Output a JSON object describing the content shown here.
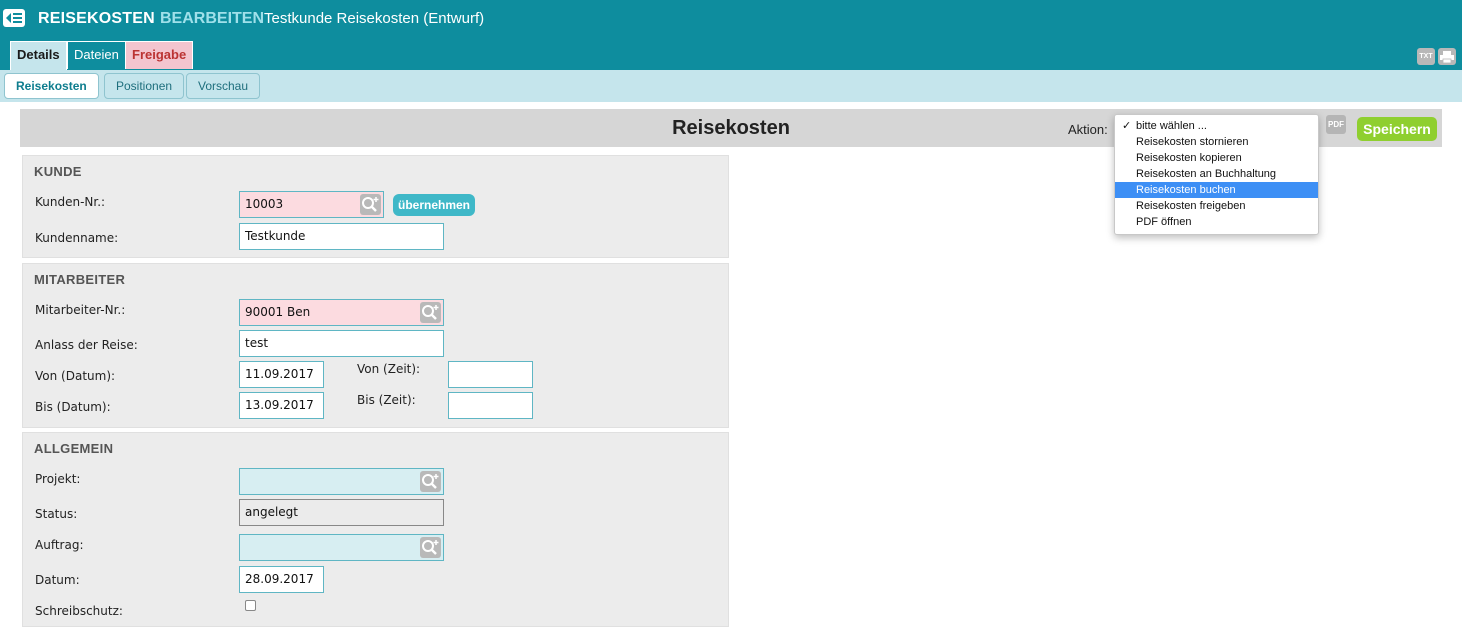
{
  "header": {
    "module": "REISEKOSTEN",
    "mode": "BEARBEITEN",
    "document": "Testkunde Reisekosten (Entwurf)",
    "tabs": {
      "details": "Details",
      "dateien": "Dateien",
      "freigabe": "Freigabe"
    },
    "icons": {
      "txt": "TXT"
    }
  },
  "subtabs": {
    "reisekosten": "Reisekosten",
    "positionen": "Positionen",
    "vorschau": "Vorschau"
  },
  "toolbar": {
    "title": "Reisekosten",
    "aktion_label": "Aktion:",
    "pdf_label": "PDF",
    "save_label": "Speichern"
  },
  "aktion_dropdown": {
    "items": [
      "bitte wählen ...",
      "Reisekosten stornieren",
      "Reisekosten kopieren",
      "Reisekosten an Buchhaltung",
      "Reisekosten buchen",
      "Reisekosten freigeben",
      "PDF öffnen"
    ],
    "checked_index": 0,
    "highlighted_index": 4
  },
  "kunde": {
    "title": "KUNDE",
    "kundennr_label": "Kunden-Nr.:",
    "kundennr_value": "10003",
    "take_label": "übernehmen",
    "kundenname_label": "Kundenname:",
    "kundenname_value": "Testkunde"
  },
  "mitarbeiter": {
    "title": "MITARBEITER",
    "nr_label": "Mitarbeiter-Nr.:",
    "nr_value": "90001 Ben",
    "anlass_label": "Anlass der Reise:",
    "anlass_value": "test",
    "von_datum_label": "Von (Datum):",
    "von_datum_value": "11.09.2017",
    "bis_datum_label": "Bis (Datum):",
    "bis_datum_value": "13.09.2017",
    "von_zeit_label": "Von (Zeit):",
    "von_zeit_value": "",
    "bis_zeit_label": "Bis (Zeit):",
    "bis_zeit_value": ""
  },
  "allgemein": {
    "title": "ALLGEMEIN",
    "projekt_label": "Projekt:",
    "projekt_value": "",
    "status_label": "Status:",
    "status_value": "angelegt",
    "auftrag_label": "Auftrag:",
    "auftrag_value": "",
    "datum_label": "Datum:",
    "datum_value": "28.09.2017",
    "schreibschutz_label": "Schreibschutz:",
    "schreibschutz_checked": false
  }
}
